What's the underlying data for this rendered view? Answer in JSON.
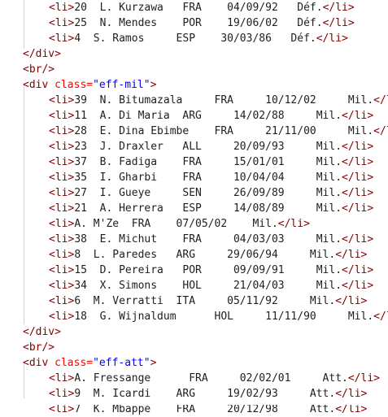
{
  "colors": {
    "tag": "#800000",
    "attr": "#ff0000",
    "value": "#0000ff",
    "text": "#1e1e1e"
  },
  "top_items": [
    {
      "num": "20",
      "text": "L. Kurzawa   FRA    04/09/92   Déf."
    },
    {
      "num": "25",
      "text": "N. Mendes    POR    19/06/02   Déf."
    },
    {
      "num": "4",
      "text": "S. Ramos     ESP    30/03/86   Déf."
    }
  ],
  "mil": {
    "class_value": "\"eff-mil\"",
    "items": [
      {
        "num": "39",
        "text": "N. Bitumazala     FRA     10/12/02     Mil."
      },
      {
        "num": "11",
        "text": "A. Di Maria  ARG     14/02/88     Mil."
      },
      {
        "num": "28",
        "text": "E. Dina Ebimbe    FRA     21/11/00     Mil."
      },
      {
        "num": "23",
        "text": "J. Draxler   ALL     20/09/93     Mil."
      },
      {
        "num": "37",
        "text": "B. Fadiga    FRA     15/01/01     Mil."
      },
      {
        "num": "35",
        "text": "I. Gharbi    FRA     10/04/04     Mil."
      },
      {
        "num": "27",
        "text": "I. Gueye     SEN     26/09/89     Mil."
      },
      {
        "num": "21",
        "text": "A. Herrera   ESP     14/08/89     Mil."
      },
      {
        "num": "",
        "text": "A. M'Ze  FRA    07/05/02    Mil."
      },
      {
        "num": "38",
        "text": "E. Michut    FRA     04/03/03     Mil."
      },
      {
        "num": "8",
        "text": "L. Paredes   ARG     29/06/94     Mil."
      },
      {
        "num": "15",
        "text": "D. Pereira   POR     09/09/91     Mil."
      },
      {
        "num": "34",
        "text": "X. Simons    HOL     21/04/03     Mil."
      },
      {
        "num": "6",
        "text": "M. Verratti  ITA     05/11/92     Mil."
      },
      {
        "num": "18",
        "text": "G. Wijnaldum      HOL     11/11/90     Mil."
      }
    ]
  },
  "att": {
    "class_value": "\"eff-att\"",
    "items": [
      {
        "num": "",
        "text": "A. Fressange      FRA     02/02/01     Att."
      },
      {
        "num": "9",
        "text": "M. Icardi    ARG     19/02/93     Att."
      },
      {
        "num": "7",
        "text": "K. Mbappé    FRA     20/12/98     Att."
      }
    ]
  },
  "tags": {
    "li_open": "<li>",
    "li_close": "</li>",
    "div_close": "</div>",
    "br": "<br/>",
    "div_open_start": "<div ",
    "div_open_end": ">",
    "class_attr": "class="
  }
}
